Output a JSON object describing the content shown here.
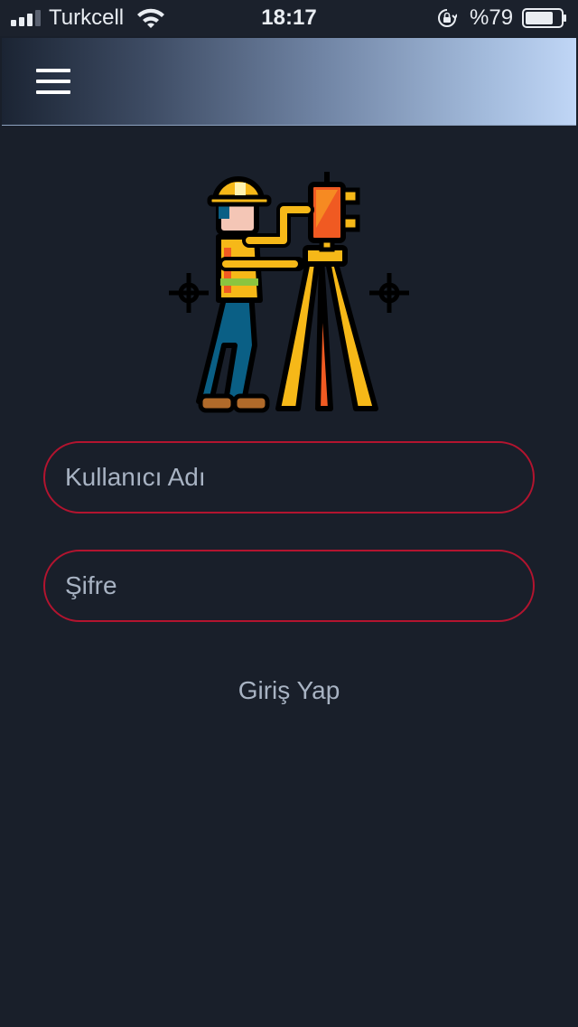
{
  "status_bar": {
    "carrier": "Turkcell",
    "time": "18:17",
    "battery": "%79",
    "battery_level": 0.79,
    "signal_icon": "signal-bars-icon",
    "wifi_icon": "wifi-icon",
    "lock_icon": "orientation-lock-icon"
  },
  "header": {
    "menu_icon": "hamburger-menu-icon"
  },
  "hero": {
    "icon": "surveyor-with-theodolite-illustration"
  },
  "login_form": {
    "username_placeholder": "Kullanıcı Adı",
    "username_value": "",
    "password_placeholder": "Şifre",
    "password_value": "",
    "submit_label": "Giriş Yap"
  },
  "colors": {
    "background": "#191f2a",
    "input_border": "#b3142f",
    "placeholder_text": "#a8b3c3",
    "header_gradient_start": "#1b2433",
    "header_gradient_end": "#c0d6f6"
  }
}
